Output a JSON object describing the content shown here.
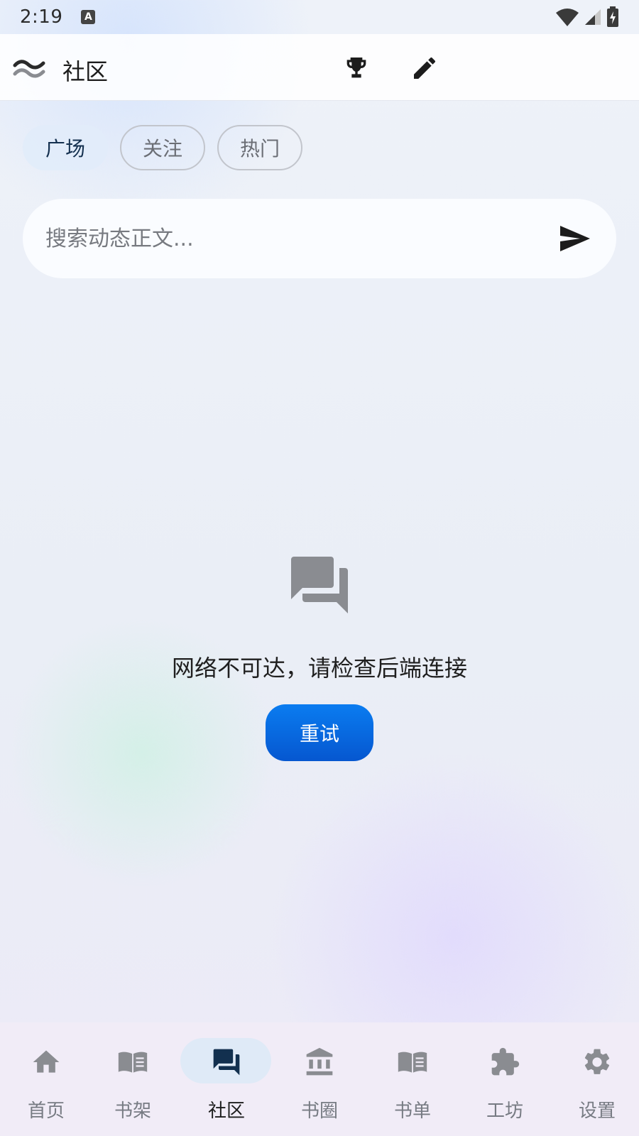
{
  "status_bar": {
    "time": "2:19",
    "indicator": "A"
  },
  "app_bar": {
    "title": "社区"
  },
  "tabs": [
    {
      "label": "广场",
      "active": true
    },
    {
      "label": "关注",
      "active": false
    },
    {
      "label": "热门",
      "active": false
    }
  ],
  "search": {
    "placeholder": "搜索动态正文..."
  },
  "empty_state": {
    "message": "网络不可达，请检查后端连接",
    "retry_label": "重试"
  },
  "bottom_nav": [
    {
      "label": "首页",
      "icon": "home-icon",
      "active": false
    },
    {
      "label": "书架",
      "icon": "open-book-icon",
      "active": false
    },
    {
      "label": "社区",
      "icon": "forum-icon",
      "active": true
    },
    {
      "label": "书圈",
      "icon": "bank-icon",
      "active": false
    },
    {
      "label": "书单",
      "icon": "open-book-icon",
      "active": false
    },
    {
      "label": "工坊",
      "icon": "puzzle-icon",
      "active": false
    },
    {
      "label": "设置",
      "icon": "gear-icon",
      "active": false
    }
  ],
  "colors": {
    "accent": "#0a6ee6",
    "nav_active_pill": "#dfeaf7",
    "icon_gray": "#8a8c91"
  }
}
